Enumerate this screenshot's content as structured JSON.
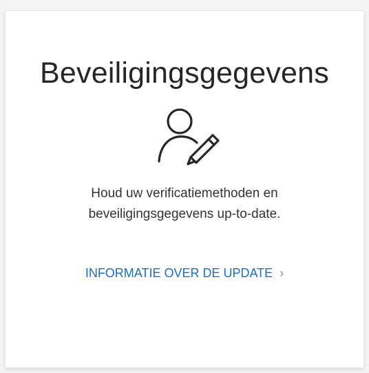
{
  "card": {
    "title": "Beveiligingsgegevens",
    "icon": "user-edit-icon",
    "description_line1": "Houd uw verificatiemethoden en",
    "description_line2": "beveiligingsgegevens up-to-date.",
    "link_label": "INFORMATIE OVER DE UPDATE",
    "link_chevron": "›"
  },
  "colors": {
    "link": "#1a6fc4",
    "title": "#262626",
    "text": "#333333",
    "background": "#f3f3f3",
    "card": "#ffffff"
  }
}
